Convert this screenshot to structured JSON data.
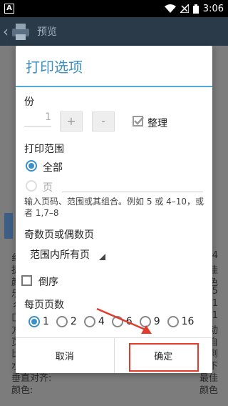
{
  "status_bar": {
    "left_icon_label": "A",
    "time": "3:06",
    "icons": [
      "wifi-icon",
      "signal-icon",
      "battery-icon"
    ]
  },
  "appbar": {
    "back_glyph": "‹",
    "title": "预览"
  },
  "background_rows": [
    {
      "left": "纟",
      "right": "4"
    },
    {
      "left": "抈",
      "right": "佳"
    },
    {
      "left": "颜",
      "right": "色"
    },
    {
      "left": "乐",
      "right": "5"
    },
    {
      "left": "彳",
      "right": "1"
    },
    {
      "left": "匚",
      "right": "1"
    },
    {
      "left": "方",
      "right": "动"
    },
    {
      "left": "页",
      "right": "自"
    },
    {
      "left": "比",
      "right": "剩"
    },
    {
      "left": "水平对齐:",
      "right": "剩下"
    },
    {
      "left": "垂直对齐:",
      "right": "最佳"
    },
    {
      "left": "颜色:",
      "right": "颜色"
    }
  ],
  "dialog": {
    "title": "打印选项",
    "copies_label": "份",
    "copies_value": "1",
    "plus_label": "+",
    "minus_label": "-",
    "collate_label": "整理",
    "collate_checked": true,
    "range_label": "打印范围",
    "range_all_label": "全部",
    "range_all_selected": true,
    "range_pages_label": "页",
    "range_pages_selected": false,
    "range_hint": "输入页码、范围或其组合。例如 5 或 4–10，或者 1,7–8",
    "odd_even_label": "奇数页或偶数页",
    "odd_even_value": "范围内所有页",
    "reverse_label": "倒序",
    "reverse_checked": false,
    "per_page_label": "每页页数",
    "per_page_options": [
      "1",
      "2",
      "4",
      "6",
      "9",
      "16"
    ],
    "per_page_selected": "1",
    "cancel_label": "取消",
    "confirm_label": "确定"
  },
  "colors": {
    "accent": "#3d8fbf",
    "annotation_red": "#e23a2b"
  }
}
